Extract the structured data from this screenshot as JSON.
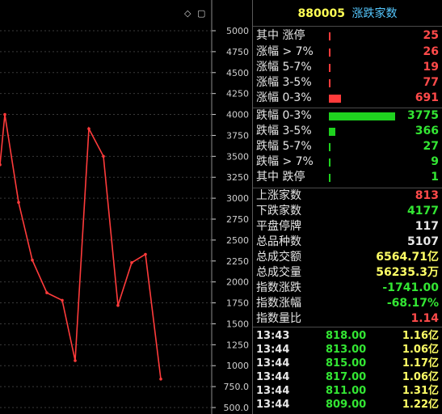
{
  "header": {
    "code": "880005",
    "name": "涨跌家数"
  },
  "stats": [
    {
      "label": "其中 涨停",
      "value": "25",
      "color": "red",
      "bar": 0.0,
      "bar_color": "#ff3b3b"
    },
    {
      "label": "涨幅 > 7%",
      "value": "26",
      "color": "red",
      "bar": 0.0,
      "bar_color": "#ff3b3b"
    },
    {
      "label": "涨幅 5-7%",
      "value": "19",
      "color": "red",
      "bar": 0.0,
      "bar_color": "#ff3b3b"
    },
    {
      "label": "涨幅 3-5%",
      "value": "77",
      "color": "red",
      "bar": 0.0,
      "bar_color": "#ff3b3b"
    },
    {
      "label": "涨幅 0-3%",
      "value": "691",
      "color": "red",
      "bar": 0.18,
      "bar_color": "#ff3b3b"
    },
    {
      "label": "跌幅 0-3%",
      "value": "3775",
      "color": "green",
      "bar": 1.0,
      "bar_color": "#1fd21f"
    },
    {
      "label": "跌幅 3-5%",
      "value": "366",
      "color": "green",
      "bar": 0.1,
      "bar_color": "#1fd21f"
    },
    {
      "label": "跌幅 5-7%",
      "value": "27",
      "color": "green",
      "bar": 0.0,
      "bar_color": "#1fd21f"
    },
    {
      "label": "跌幅 > 7%",
      "value": "9",
      "color": "green",
      "bar": 0.0,
      "bar_color": "#1fd21f"
    },
    {
      "label": "其中 跌停",
      "value": "1",
      "color": "green",
      "bar": 0.0,
      "bar_color": "#1fd21f"
    }
  ],
  "summary": [
    {
      "label": "上涨家数",
      "value": "813",
      "color": "red"
    },
    {
      "label": "下跌家数",
      "value": "4177",
      "color": "green"
    },
    {
      "label": "平盘停牌",
      "value": "117",
      "color": "white"
    },
    {
      "label": "总品种数",
      "value": "5107",
      "color": "white"
    },
    {
      "label": "总成交额",
      "value": "6564.71亿",
      "color": "yellow"
    },
    {
      "label": "总成交量",
      "value": "56235.3万",
      "color": "yellow"
    },
    {
      "label": "指数涨跌",
      "value": "-1741.00",
      "color": "green"
    },
    {
      "label": "指数涨幅",
      "value": "-68.17%",
      "color": "green"
    },
    {
      "label": "指数量比",
      "value": "1.14",
      "color": "red"
    }
  ],
  "ticks": [
    {
      "time": "13:43",
      "price": "818.00",
      "amount": "1.16亿"
    },
    {
      "time": "13:44",
      "price": "813.00",
      "amount": "1.06亿"
    },
    {
      "time": "13:44",
      "price": "815.00",
      "amount": "1.17亿"
    },
    {
      "time": "13:44",
      "price": "817.00",
      "amount": "1.06亿"
    },
    {
      "time": "13:44",
      "price": "811.00",
      "amount": "1.31亿"
    },
    {
      "time": "13:44",
      "price": "809.00",
      "amount": "1.22亿"
    }
  ],
  "chart_data": {
    "type": "line",
    "series": [
      {
        "values": [
          3400,
          4000,
          2950,
          2260,
          1870,
          1780,
          1060,
          3830,
          3500,
          1720,
          2230,
          2330,
          840
        ]
      }
    ],
    "y_ticks": [
      "5000",
      "4750",
      "4500",
      "4250",
      "4000",
      "3750",
      "3500",
      "3250",
      "3000",
      "2750",
      "2500",
      "2250",
      "2000",
      "1750",
      "1500",
      "1250",
      "1000",
      "750.0",
      "500.0"
    ],
    "ylim": [
      500,
      5000
    ],
    "line_color": "#ff3b3b"
  },
  "icons": {
    "diamond": "◇",
    "window": "▢"
  }
}
